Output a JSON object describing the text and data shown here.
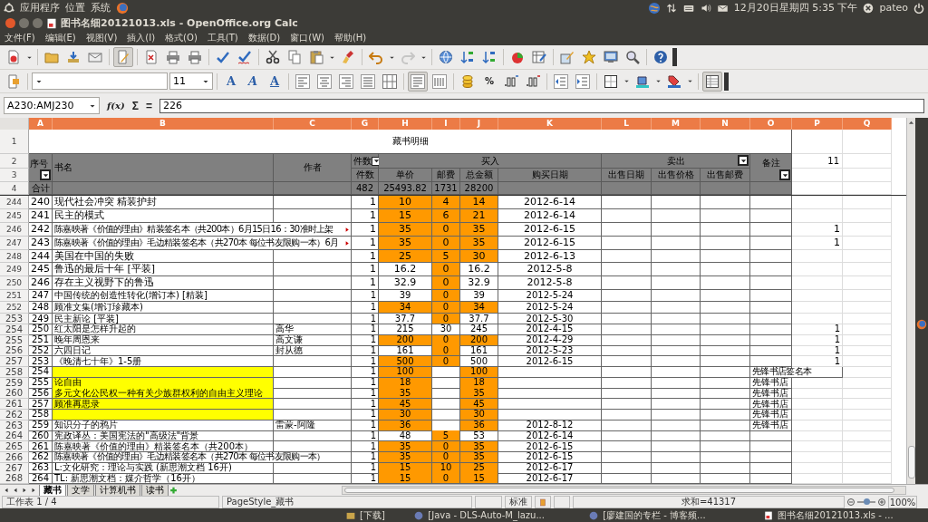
{
  "top_panel": {
    "menus": [
      "应用程序",
      "位置",
      "系统"
    ],
    "clock": "12月20日星期四 5:35 下午",
    "user": "pateo"
  },
  "window": {
    "title": "图书名细20121013.xls - OpenOffice.org Calc"
  },
  "menus": [
    "文件(F)",
    "编辑(E)",
    "视图(V)",
    "插入(I)",
    "格式(O)",
    "工具(T)",
    "数据(D)",
    "窗口(W)",
    "帮助(H)"
  ],
  "toolbar_1": [
    {
      "pressed": false,
      "disabled": false
    },
    {
      "pressed": false,
      "disabled": false
    },
    {
      "pressed": false,
      "disabled": false
    },
    {
      "pressed": false,
      "disabled": false
    },
    {
      "pressed": true,
      "disabled": false
    },
    {
      "pressed": false,
      "disabled": false
    },
    {
      "pressed": false,
      "disabled": false
    },
    {
      "pressed": false,
      "disabled": false
    },
    {
      "pressed": false,
      "disabled": false
    },
    {
      "pressed": false,
      "disabled": false
    },
    {
      "pressed": false,
      "disabled": false
    },
    {
      "pressed": false,
      "disabled": false
    },
    {
      "pressed": false,
      "disabled": false
    },
    {
      "pressed": false,
      "disabled": false
    },
    {
      "pressed": false,
      "disabled": false
    },
    {
      "pressed": false,
      "disabled": true
    },
    {
      "pressed": false,
      "disabled": false
    },
    {
      "pressed": false,
      "disabled": false
    },
    {
      "pressed": false,
      "disabled": false
    },
    {
      "pressed": false,
      "disabled": false
    },
    {
      "pressed": false,
      "disabled": false
    },
    {
      "pressed": false,
      "disabled": false
    },
    {
      "pressed": false,
      "disabled": false
    },
    {
      "pressed": false,
      "disabled": false
    },
    {
      "pressed": false,
      "disabled": false
    },
    {
      "pressed": false,
      "disabled": false
    }
  ],
  "toolbar_2": {
    "font_size": "11",
    "buttons": [
      {
        "pressed": false
      },
      {
        "pressed": false,
        "text": "A"
      },
      {
        "pressed": false,
        "text": "A"
      },
      {
        "pressed": false,
        "text": "A"
      },
      {
        "pressed": false
      },
      {
        "pressed": false
      },
      {
        "pressed": false
      },
      {
        "pressed": false
      },
      {
        "pressed": false
      },
      {
        "pressed": true
      },
      {
        "pressed": false
      },
      {
        "pressed": false
      },
      {
        "pressed": false,
        "text": "%"
      },
      {
        "pressed": false
      },
      {
        "pressed": false
      },
      {
        "pressed": false
      },
      {
        "pressed": false
      },
      {
        "pressed": false
      },
      {
        "pressed": false
      },
      {
        "pressed": false
      },
      {
        "pressed": true
      }
    ]
  },
  "formula_bar": {
    "name_box": "A230:AMJ230",
    "function_wizard": "f(x)",
    "sum": "Σ",
    "equals": "=",
    "value": "226"
  },
  "columns": [
    {
      "label": "A",
      "selected": true
    },
    {
      "label": "B",
      "selected": true
    },
    {
      "label": "C",
      "selected": true
    },
    {
      "label": "G",
      "selected": true
    },
    {
      "label": "H",
      "selected": true
    },
    {
      "label": "I",
      "selected": true
    },
    {
      "label": "J",
      "selected": true
    },
    {
      "label": "K",
      "selected": true
    },
    {
      "label": "L",
      "selected": true
    },
    {
      "label": "M",
      "selected": true
    },
    {
      "label": "N",
      "selected": true
    },
    {
      "label": "O",
      "selected": true
    },
    {
      "label": "P",
      "selected": true
    },
    {
      "label": "Q",
      "selected": true
    }
  ],
  "sheet_header": {
    "row_numbers": [
      "1",
      "2",
      "3",
      "4"
    ],
    "title": "藏书明细",
    "seq": {
      "text": "序号",
      "filter": true
    },
    "book": "书名",
    "author": "作者",
    "count": {
      "text": "件数",
      "filter": true
    },
    "buy": "买入",
    "sell": {
      "text": "卖出",
      "filter": true
    },
    "note": {
      "text": "备注",
      "filter": true
    },
    "p2": "11",
    "sub_columns": [
      "件数",
      "单价",
      "邮费",
      "总金额",
      "购买日期",
      "出售日期",
      "出售价格",
      "出售邮费"
    ],
    "totals_label": "合计",
    "totals": [
      "482",
      "25493.82",
      "1731",
      "28200"
    ]
  },
  "rows": [
    {
      "row": "244",
      "a": "240",
      "b": "现代社会冲突 精装护封",
      "g": "1",
      "h": {
        "text": "10",
        "color": "#ff9900"
      },
      "i": {
        "text": "4",
        "color": "#ff9900"
      },
      "j": {
        "text": "14",
        "color": "#ff9900"
      },
      "k": "2012-6-14"
    },
    {
      "row": "245",
      "a": "241",
      "b": "民主的模式",
      "g": "1",
      "h": {
        "text": "15",
        "color": "#ff9900"
      },
      "i": {
        "text": "6",
        "color": "#ff9900"
      },
      "j": {
        "text": "21",
        "color": "#ff9900"
      },
      "k": "2012-6-14"
    },
    {
      "row": "246",
      "a": "242",
      "b": {
        "text": "陈嘉映著《价值的理由》精装签名本（共200本）6月15日16：30准时上架",
        "kind": "clipped"
      },
      "g": "1",
      "h": {
        "text": "35",
        "color": "#ff9900"
      },
      "i": {
        "text": "0",
        "color": "#ff9900"
      },
      "j": {
        "text": "35",
        "color": "#ff9900"
      },
      "k": "2012-6-15",
      "p": "1"
    },
    {
      "row": "247",
      "a": "243",
      "b": {
        "text": "陈嘉映著《价值的理由》毛边精装签名本（共270本 每位书友限购一本）6月",
        "kind": "clipped"
      },
      "g": "1",
      "h": {
        "text": "35",
        "color": "#ff9900"
      },
      "i": {
        "text": "0",
        "color": "#ff9900"
      },
      "j": {
        "text": "35",
        "color": "#ff9900"
      },
      "k": "2012-6-15",
      "p": "1"
    },
    {
      "row": "248",
      "a": "244",
      "b": "美国在中国的失败",
      "g": "1",
      "h": {
        "text": "25",
        "color": "#ff9900"
      },
      "i": {
        "text": "5",
        "color": "#ff9900"
      },
      "j": {
        "text": "30",
        "color": "#ff9900"
      },
      "k": "2012-6-13"
    },
    {
      "row": "249",
      "a": "245",
      "b": "鲁迅的最后十年 [平装]",
      "g": "1",
      "h": "16.2",
      "i": {
        "text": "0",
        "color": "#ff9900"
      },
      "j": "16.2",
      "k": "2012-5-8"
    },
    {
      "row": "250",
      "a": "246",
      "b": "存在主义视野下的鲁迅",
      "g": "1",
      "h": "32.9",
      "i": {
        "text": "0",
        "color": "#ff9900"
      },
      "j": "32.9",
      "k": "2012-5-8"
    },
    {
      "row": "251",
      "a": "247",
      "b": "中国传统的创造性转化(增订本) [精装]",
      "g": "1",
      "h": "39",
      "i": {
        "text": "0",
        "color": "#ff9900"
      },
      "j": "39",
      "k": "2012-5-24"
    },
    {
      "row": "252",
      "a": "248",
      "b": "顾准文集(增订珍藏本)",
      "g": "1",
      "h": {
        "text": "34",
        "color": "#ff9900"
      },
      "i": {
        "text": "0",
        "color": "#ff9900"
      },
      "j": {
        "text": "34",
        "color": "#ff9900"
      },
      "k": "2012-5-24"
    },
    {
      "row": "253",
      "a": "249",
      "b": "民主新论 [平装]",
      "g": "1",
      "h": "37.7",
      "i": {
        "text": "0",
        "color": "#ff9900"
      },
      "j": "37.7",
      "k": "2012-5-30"
    },
    {
      "row": "254",
      "a": "250",
      "b": "红太阳是怎样升起的",
      "c": "高华",
      "g": "1",
      "h": "215",
      "i": "30",
      "j": "245",
      "k": "2012-4-15",
      "p": "1"
    },
    {
      "row": "255",
      "a": "251",
      "b": "晚年周恩来",
      "c": "高文谦",
      "g": "1",
      "h": {
        "text": "200",
        "color": "#ff9900"
      },
      "i": {
        "text": "0",
        "color": "#ff9900"
      },
      "j": {
        "text": "200",
        "color": "#ff9900"
      },
      "k": "2012-4-29",
      "p": "1"
    },
    {
      "row": "256",
      "a": "252",
      "b": "六四日记",
      "c": "封从德",
      "g": "1",
      "h": "161",
      "i": {
        "text": "0",
        "color": "#ff9900"
      },
      "j": "161",
      "k": "2012-5-23",
      "p": "1"
    },
    {
      "row": "257",
      "a": "253",
      "b": "《晚清七十年》1-5册",
      "g": "1",
      "h": {
        "text": "500",
        "color": "#ff9900"
      },
      "i": {
        "text": "0",
        "color": "#ff9900"
      },
      "j": "500",
      "k": "2012-6-15",
      "p": "1"
    },
    {
      "row": "258",
      "a": "254",
      "b": {
        "color": "#ffff00"
      },
      "g": "1",
      "h": {
        "text": "100",
        "color": "#ff9900"
      },
      "j": {
        "text": "100",
        "color": "#ff9900"
      },
      "o": {
        "text": "先锋书店签名本",
        "kind": "spill"
      }
    },
    {
      "row": "259",
      "a": "255",
      "b": {
        "text": "论自由",
        "color": "#ffff00"
      },
      "g": "1",
      "h": {
        "text": "18",
        "color": "#ff9900"
      },
      "j": {
        "text": "18",
        "color": "#ff9900"
      },
      "o": "先锋书店"
    },
    {
      "row": "260",
      "a": "256",
      "b": {
        "text": "多元文化公民权一种有关少族群权利的自由主义理论",
        "color": "#ffff00"
      },
      "g": "1",
      "h": {
        "text": "35",
        "color": "#ff9900"
      },
      "j": {
        "text": "35",
        "color": "#ff9900"
      },
      "o": "先锋书店"
    },
    {
      "row": "261",
      "a": "257",
      "b": {
        "text": "顾准再思录",
        "color": "#ffff00"
      },
      "g": "1",
      "h": {
        "text": "45",
        "color": "#ff9900"
      },
      "j": {
        "text": "45",
        "color": "#ff9900"
      },
      "o": "先锋书店"
    },
    {
      "row": "262",
      "a": "258",
      "b": {
        "color": "#ffff00"
      },
      "g": "1",
      "h": {
        "text": "30",
        "color": "#ff9900"
      },
      "j": {
        "text": "30",
        "color": "#ff9900"
      },
      "o": "先锋书店"
    },
    {
      "row": "263",
      "a": "259",
      "b": "知识分子的鸦片",
      "c": "雷蒙-阿隆",
      "g": "1",
      "h": {
        "text": "36",
        "color": "#ff9900"
      },
      "j": {
        "text": "36",
        "color": "#ff9900"
      },
      "k": "2012-8-12",
      "o": "先锋书店"
    },
    {
      "row": "264",
      "a": "260",
      "b": "宪政译丛：美国宪法的\"高级法\"背景",
      "g": "1",
      "h": "48",
      "i": {
        "text": "5",
        "color": "#ff9900"
      },
      "j": "53",
      "k": "2012-6-14"
    },
    {
      "row": "265",
      "a": "261",
      "b": "陈嘉映著《价值的理由》精装签名本（共200本）",
      "g": "1",
      "h": {
        "text": "35",
        "color": "#ff9900"
      },
      "i": {
        "text": "0",
        "color": "#ff9900"
      },
      "j": {
        "text": "35",
        "color": "#ff9900"
      },
      "k": "2012-6-15"
    },
    {
      "row": "266",
      "a": "262",
      "b": {
        "text": "陈嘉映著《价值的理由》毛边精装签名本（共270本 每位书友限购一本）",
        "kind": "spill"
      },
      "g": "1",
      "h": {
        "text": "35",
        "color": "#ff9900"
      },
      "i": {
        "text": "0",
        "color": "#ff9900"
      },
      "j": {
        "text": "35",
        "color": "#ff9900"
      },
      "k": "2012-6-15"
    },
    {
      "row": "267",
      "a": "263",
      "b": "L:文化研究：理论与实践 (新思潮文档 16开)",
      "g": "1",
      "h": {
        "text": "15",
        "color": "#ff9900"
      },
      "i": {
        "text": "10",
        "color": "#ff9900"
      },
      "j": {
        "text": "25",
        "color": "#ff9900"
      },
      "k": "2012-6-17"
    },
    {
      "row": "268",
      "a": "264",
      "b": "TL: 新思潮文档：媒介哲学（16开）",
      "g": "1",
      "h": {
        "text": "15",
        "color": "#ff9900"
      },
      "i": {
        "text": "0",
        "color": "#ff9900"
      },
      "j": {
        "text": "15",
        "color": "#ff9900"
      },
      "k": "2012-6-17"
    }
  ],
  "sheet_tabs": [
    {
      "label": "藏书",
      "selected": true
    },
    {
      "label": "文学",
      "selected": false
    },
    {
      "label": "计算机书",
      "selected": false
    },
    {
      "label": "读书",
      "selected": false
    }
  ],
  "status_bar": {
    "sheet": "工作表 1 / 4",
    "page_style": "PageStyle_藏书",
    "mode": "标准",
    "sum": "求和=41317",
    "zoom": {
      "level": 0.5
    },
    "zoom_percent": "100%"
  },
  "taskbar": [
    "[下载]",
    "[Java - DLS-Auto-M_lazu...",
    "[廖建国的专栏 - 博客频...",
    "图书名细20121013.xls - ..."
  ]
}
